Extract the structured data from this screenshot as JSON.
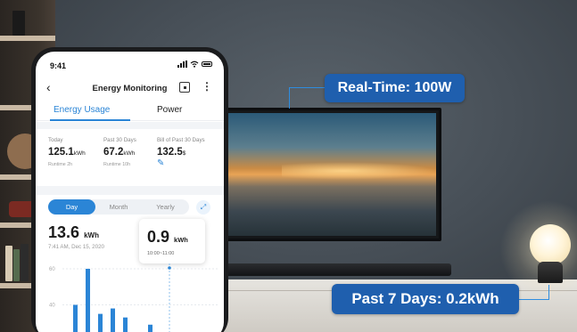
{
  "callouts": {
    "realtime": "Real-Time: 100W",
    "past7": "Past 7 Days: 0.2kWh"
  },
  "phone": {
    "status_time": "9:41",
    "header": {
      "title": "Energy Monitoring",
      "back_icon": "chevron-left-icon",
      "calendar_icon": "calendar-icon",
      "more_icon": "more-vertical-icon"
    },
    "tabs": [
      {
        "label": "Energy Usage",
        "active": true
      },
      {
        "label": "Power",
        "active": false
      }
    ],
    "stats": [
      {
        "label": "Today",
        "value": "125.1",
        "unit": "kWh",
        "sub": "Runtime 2h"
      },
      {
        "label": "Past 30 Days",
        "value": "67.2",
        "unit": "kWh",
        "sub": "Runtime 10h"
      },
      {
        "label": "Bill of Past 30 Days",
        "value": "132.5",
        "unit": "$",
        "sub": ""
      }
    ],
    "range_tabs": [
      {
        "label": "Day",
        "active": true
      },
      {
        "label": "Month",
        "active": false
      },
      {
        "label": "Yearly",
        "active": false
      }
    ],
    "total": {
      "value": "13.6",
      "unit": "kWh",
      "timestamp": "7:41 AM, Dec 15, 2020"
    },
    "tooltip": {
      "value": "0.9",
      "unit": "kWh",
      "range": "10:00~11:00"
    },
    "accent": "#2b85d6"
  },
  "chart_data": {
    "type": "bar",
    "ylim": [
      20,
      60
    ],
    "yticks": [
      "60",
      "40"
    ],
    "values": [
      20.5,
      40,
      60,
      35,
      38,
      33,
      21,
      29,
      22
    ]
  }
}
